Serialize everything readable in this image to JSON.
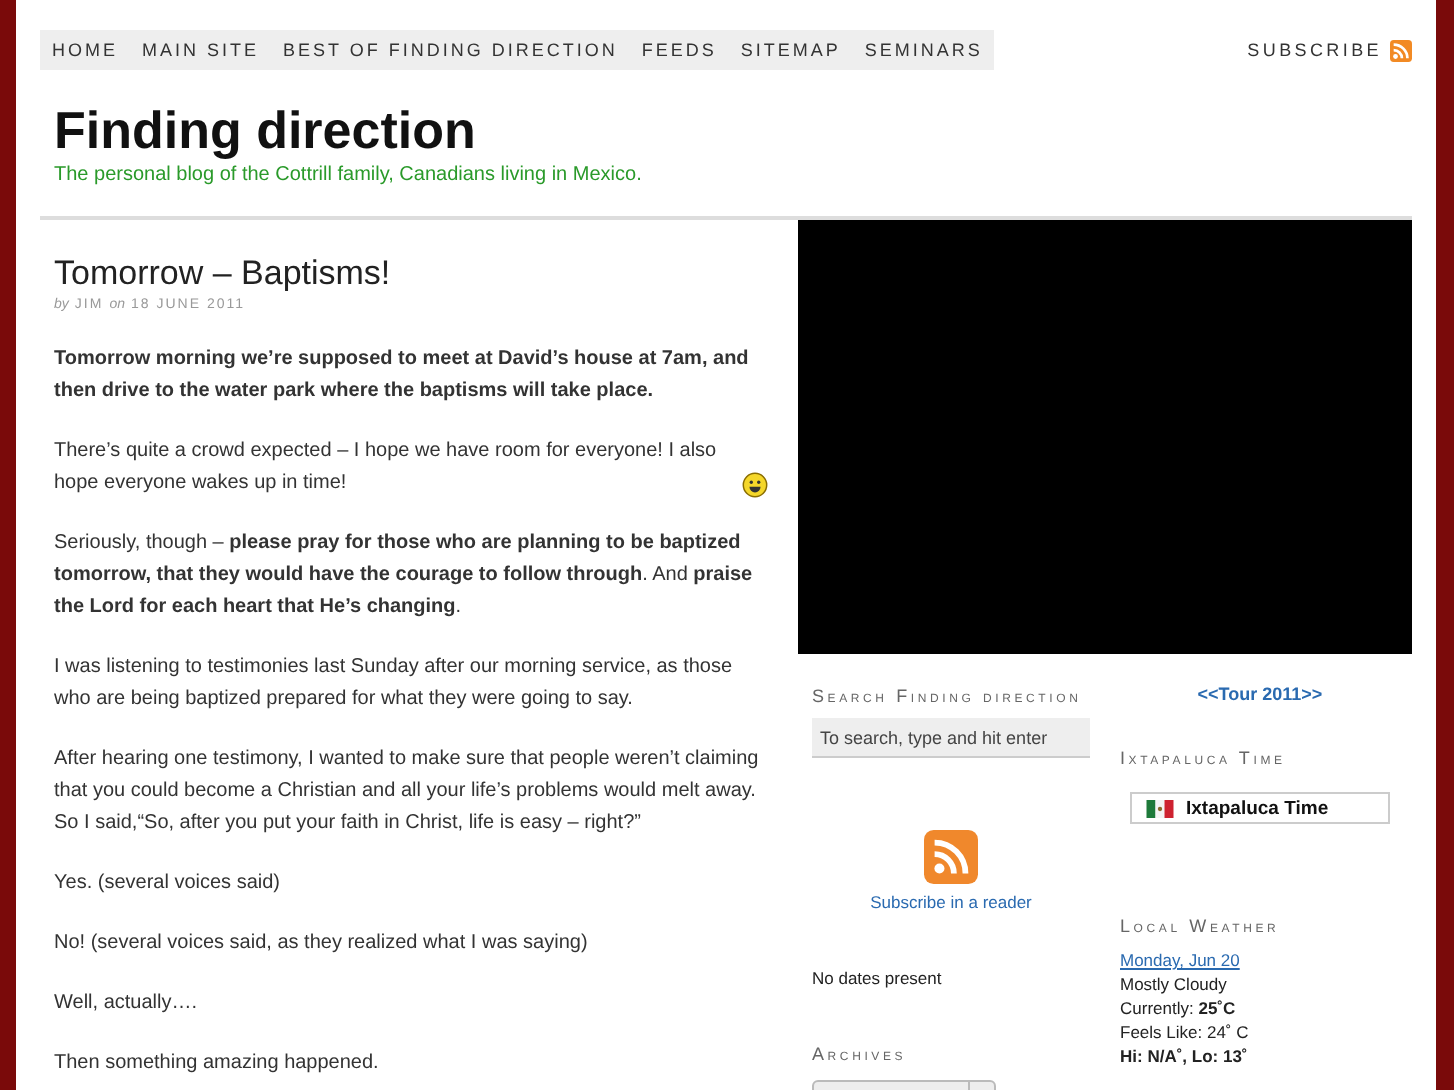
{
  "nav": {
    "items": [
      {
        "label": "HOME"
      },
      {
        "label": "MAIN SITE"
      },
      {
        "label": "BEST OF FINDING DIRECTION"
      },
      {
        "label": "FEEDS"
      },
      {
        "label": "SITEMAP"
      },
      {
        "label": "SEMINARS"
      }
    ],
    "subscribe": "SUBSCRIBE"
  },
  "header": {
    "title": "Finding direction",
    "tagline": "The personal blog of the Cottrill family, Canadians living in Mexico."
  },
  "post": {
    "title": "Tomorrow – Baptisms!",
    "meta": [
      {
        "text": "by",
        "kind": "label"
      },
      {
        "text": "JIM",
        "kind": "value"
      },
      {
        "text": "on",
        "kind": "label"
      },
      {
        "text": "18 JUNE 2011",
        "kind": "value"
      }
    ],
    "paragraphs": [
      {
        "text": "**Tomorrow morning we’re supposed to meet at David’s house at 7am, and then drive to the water park where the baptisms will take place.**",
        "smiley": false
      },
      {
        "text": "There’s quite a crowd expected – I hope we have room for everyone!  I also hope everyone wakes up in time!",
        "smiley": true
      },
      {
        "text": "Seriously, though – **please pray for those who are planning to be baptized tomorrow, that they would have the courage to follow through**.  And **praise the Lord for each heart that He’s changing**.",
        "smiley": false
      },
      {
        "text": "I was listening to testimonies last Sunday after our morning service, as those who are being baptized prepared for what they were going to say.",
        "smiley": false
      },
      {
        "text": "After hearing one testimony, I wanted to make sure that people weren’t claiming that you could become a Christian and all your life’s problems would melt away.  So I said,“So, after you put your faith in Christ, life is easy – right?”",
        "smiley": false
      },
      {
        "text": "Yes.  (several voices said)",
        "smiley": false
      },
      {
        "text": "No!  (several voices said, as they realized what I was saying)",
        "smiley": false
      },
      {
        "text": "Well, actually….",
        "smiley": false
      },
      {
        "text": "Then something amazing happened.",
        "smiley": false
      }
    ]
  },
  "sidebar": {
    "search_heading": "Search Finding direction",
    "search": {
      "placeholder": "To search, type and hit enter"
    },
    "reader_link": "Subscribe in a reader",
    "no_dates": "No dates present",
    "archives_heading": "Archives",
    "tour_link": "<<Tour 2011>>",
    "time_heading": "Ixtapaluca Time",
    "time_widget": "Ixtapaluca Time",
    "weather_heading": "Local Weather",
    "weather": [
      {
        "text": "Monday, Jun 20",
        "kind": "link"
      },
      {
        "text": "Mostly Cloudy",
        "kind": "plain"
      },
      {
        "text": "Currently: **25˚C**",
        "kind": "plain"
      },
      {
        "text": "Feels Like: 24˚ C",
        "kind": "plain"
      },
      {
        "text": "Hi: N/A˚, Lo: 13˚",
        "kind": "strong"
      }
    ]
  }
}
